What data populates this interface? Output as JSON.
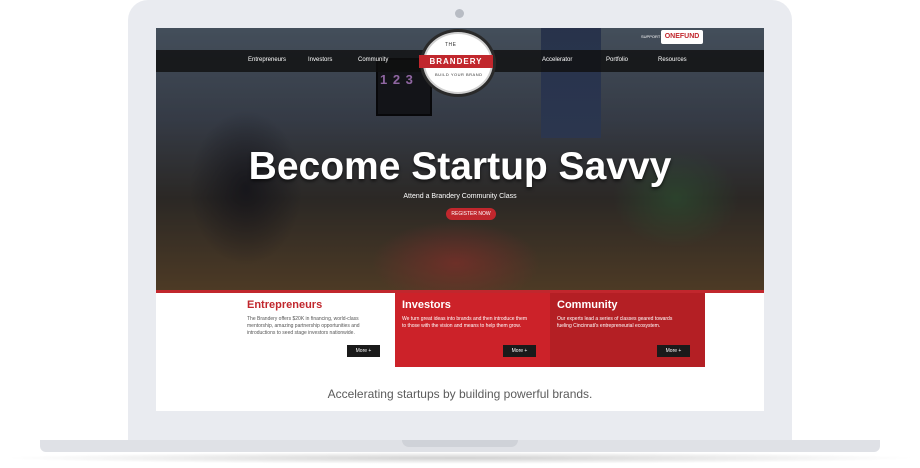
{
  "nav": {
    "items": [
      "Entrepreneurs",
      "Investors",
      "Community",
      "Accelerator",
      "Portfolio",
      "Resources"
    ]
  },
  "logo": {
    "top_text": "THE",
    "name": "BRANDERY",
    "bottom_text": "BUILD YOUR BRAND"
  },
  "sponsor": {
    "prefix": "SUPPORT",
    "name": "ONEFUND"
  },
  "hero": {
    "screen_text": "1 2 3",
    "headline": "Become Startup Savvy",
    "subtitle": "Attend a Brandery Community Class",
    "cta": "REGISTER NOW"
  },
  "panels": [
    {
      "title": "Entrepreneurs",
      "text": "The Brandery offers $20K in financing, world-class mentorship, amazing partnership opportunities and introductions to seed stage investors nationwide.",
      "button": "More +"
    },
    {
      "title": "Investors",
      "text": "We turn great ideas into brands and then introduce them to those with the vision and means to help them grow.",
      "button": "More +"
    },
    {
      "title": "Community",
      "text": "Our experts lead a series of classes geared towards fueling Cincinnati's entrepreneurial ecosystem.",
      "button": "More +"
    }
  ],
  "tagline": "Accelerating startups by building powerful brands.",
  "colors": {
    "brand_red": "#c1272d",
    "panel_red": "#cc2229",
    "panel_dark_red": "#b41f24",
    "nav_bg": "#1a1a1a"
  }
}
